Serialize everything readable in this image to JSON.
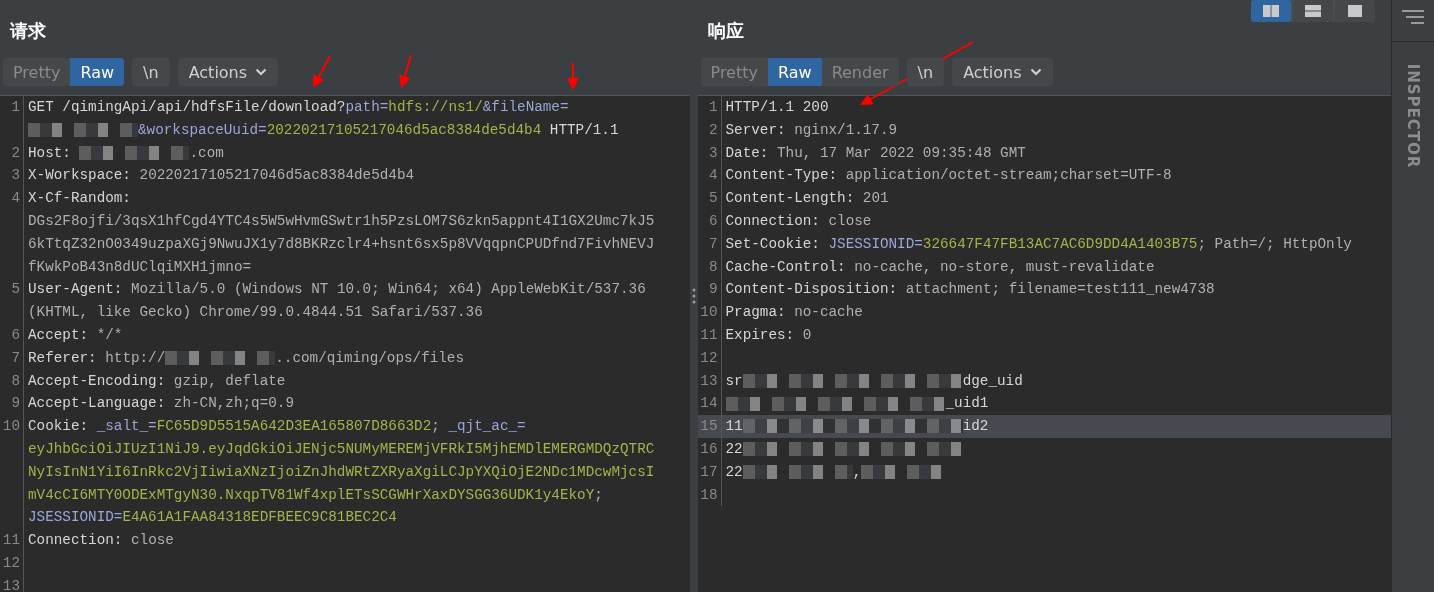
{
  "panes": [
    {
      "title": "请求",
      "view_tabs": [
        {
          "label": "Pretty",
          "selected": false
        },
        {
          "label": "Raw",
          "selected": true
        }
      ],
      "buttons": [
        {
          "label": "\\n",
          "kind": "plain"
        },
        {
          "label": "Actions",
          "kind": "menu"
        }
      ],
      "lines": [
        {
          "number": "1",
          "selected": false,
          "wraps": [
            {
              "segments": [
                {
                  "kind": "hname",
                  "text": "GET /qimingApi/api/hdfsFile/download?"
                },
                {
                  "kind": "pname",
                  "text": "path="
                },
                {
                  "kind": "pval",
                  "text": "hdfs://ns1/"
                },
                {
                  "kind": "pname",
                  "text": "&fileName="
                }
              ]
            },
            {
              "segments": [
                {
                  "kind": "redacted"
                },
                {
                  "kind": "pname",
                  "text": "&workspaceUuid="
                },
                {
                  "kind": "pval",
                  "text": "20220217105217046d5ac8384de5d4b4"
                },
                {
                  "kind": "hname",
                  "text": " HTTP/1.1"
                }
              ]
            }
          ]
        },
        {
          "number": "2",
          "selected": false,
          "wraps": [
            {
              "segments": [
                {
                  "kind": "hname",
                  "text": "Host: "
                },
                {
                  "kind": "redacted"
                },
                {
                  "kind": "hval",
                  "text": ".com"
                }
              ]
            }
          ]
        },
        {
          "number": "3",
          "selected": false,
          "wraps": [
            {
              "segments": [
                {
                  "kind": "hname",
                  "text": "X-Workspace: "
                },
                {
                  "kind": "hval",
                  "text": "20220217105217046d5ac8384de5d4b4"
                }
              ]
            }
          ]
        },
        {
          "number": "4",
          "selected": false,
          "wraps": [
            {
              "segments": [
                {
                  "kind": "hname",
                  "text": "X-Cf-Random:"
                }
              ]
            },
            {
              "segments": [
                {
                  "kind": "hval",
                  "text": "DGs2F8ojfi/3qsX1hfCgd4YTC4s5W5wHvmGSwtr1h5PzsLOM7S6zkn5appnt4I1GX2Umc7kJ5"
                }
              ]
            },
            {
              "segments": [
                {
                  "kind": "hval",
                  "text": "6kTtqZ32nO0349uzpaXGj9NwuJX1y7d8BKRzclr4+hsnt6sx5p8VVqqpnCPUDfnd7FivhNEVJ"
                }
              ]
            },
            {
              "segments": [
                {
                  "kind": "hval",
                  "text": "fKwkPoB43n8dUClqiMXH1jmno="
                }
              ]
            }
          ]
        },
        {
          "number": "5",
          "selected": false,
          "wraps": [
            {
              "segments": [
                {
                  "kind": "hname",
                  "text": "User-Agent: "
                },
                {
                  "kind": "hval",
                  "text": "Mozilla/5.0 (Windows NT 10.0; Win64; x64) AppleWebKit/537.36"
                }
              ]
            },
            {
              "segments": [
                {
                  "kind": "hval",
                  "text": "(KHTML, like Gecko) Chrome/99.0.4844.51 Safari/537.36"
                }
              ]
            }
          ]
        },
        {
          "number": "6",
          "selected": false,
          "wraps": [
            {
              "segments": [
                {
                  "kind": "hname",
                  "text": "Accept: "
                },
                {
                  "kind": "hval",
                  "text": "*/*"
                }
              ]
            }
          ]
        },
        {
          "number": "7",
          "selected": false,
          "wraps": [
            {
              "segments": [
                {
                  "kind": "hname",
                  "text": "Referer: "
                },
                {
                  "kind": "hval",
                  "text": "http://"
                },
                {
                  "kind": "redacted"
                },
                {
                  "kind": "hval",
                  "text": "..com/qiming/ops/files"
                }
              ]
            }
          ]
        },
        {
          "number": "8",
          "selected": false,
          "wraps": [
            {
              "segments": [
                {
                  "kind": "hname",
                  "text": "Accept-Encoding: "
                },
                {
                  "kind": "hval",
                  "text": "gzip, deflate"
                }
              ]
            }
          ]
        },
        {
          "number": "9",
          "selected": false,
          "wraps": [
            {
              "segments": [
                {
                  "kind": "hname",
                  "text": "Accept-Language: "
                },
                {
                  "kind": "hval",
                  "text": "zh-CN,zh;q=0.9"
                }
              ]
            }
          ]
        },
        {
          "number": "10",
          "selected": false,
          "wraps": [
            {
              "segments": [
                {
                  "kind": "hname",
                  "text": "Cookie: "
                },
                {
                  "kind": "pname",
                  "text": "_salt_="
                },
                {
                  "kind": "pval",
                  "text": "FC65D9D5515A642D3EA165807D8663D2"
                },
                {
                  "kind": "hval",
                  "text": "; "
                },
                {
                  "kind": "pname",
                  "text": "_qjt_ac_="
                }
              ]
            },
            {
              "segments": [
                {
                  "kind": "pval",
                  "text": "eyJhbGciOiJIUzI1NiJ9.eyJqdGkiOiJENjc5NUMyMEREMjVFRkI5MjhEMDlEMERGMDQzQTRC"
                }
              ]
            },
            {
              "segments": [
                {
                  "kind": "pval",
                  "text": "NyIsInN1YiI6InRkc2VjIiwiaXNzIjoiZnJhdWRtZXRyaXgiLCJpYXQiOjE2NDc1MDcwMjcsI"
                }
              ]
            },
            {
              "segments": [
                {
                  "kind": "pval",
                  "text": "mV4cCI6MTY0ODExMTgyN30.NxqpTV81Wf4xplETsSCGWHrXaxDYSGG36UDK1y4EkoY"
                },
                {
                  "kind": "hval",
                  "text": ";"
                }
              ]
            },
            {
              "segments": [
                {
                  "kind": "pname",
                  "text": "JSESSIONID="
                },
                {
                  "kind": "pval",
                  "text": "E4A61A1FAA84318EDFBEEC9C81BEC2C4"
                }
              ]
            }
          ]
        },
        {
          "number": "11",
          "selected": false,
          "wraps": [
            {
              "segments": [
                {
                  "kind": "hname",
                  "text": "Connection: "
                },
                {
                  "kind": "hval",
                  "text": "close"
                }
              ]
            }
          ]
        },
        {
          "number": "12",
          "selected": false
        },
        {
          "number": "13",
          "selected": false
        }
      ]
    },
    {
      "title": "响应",
      "view_tabs": [
        {
          "label": "Pretty",
          "selected": false
        },
        {
          "label": "Raw",
          "selected": true
        },
        {
          "label": "Render",
          "selected": false
        }
      ],
      "buttons": [
        {
          "label": "\\n",
          "kind": "plain"
        },
        {
          "label": "Actions",
          "kind": "menu"
        }
      ],
      "lines": [
        {
          "number": "1",
          "selected": false,
          "wraps": [
            {
              "segments": [
                {
                  "kind": "hname",
                  "text": "HTTP/1.1 200"
                }
              ]
            }
          ]
        },
        {
          "number": "2",
          "selected": false,
          "wraps": [
            {
              "segments": [
                {
                  "kind": "hname",
                  "text": "Server: "
                },
                {
                  "kind": "hval",
                  "text": "nginx/1.17.9"
                }
              ]
            }
          ]
        },
        {
          "number": "3",
          "selected": false,
          "wraps": [
            {
              "segments": [
                {
                  "kind": "hname",
                  "text": "Date: "
                },
                {
                  "kind": "hval",
                  "text": "Thu, 17 Mar 2022 09:35:48 GMT"
                }
              ]
            }
          ]
        },
        {
          "number": "4",
          "selected": false,
          "wraps": [
            {
              "segments": [
                {
                  "kind": "hname",
                  "text": "Content-Type: "
                },
                {
                  "kind": "hval",
                  "text": "application/octet-stream;charset=UTF-8"
                }
              ]
            }
          ]
        },
        {
          "number": "5",
          "selected": false,
          "wraps": [
            {
              "segments": [
                {
                  "kind": "hname",
                  "text": "Content-Length: "
                },
                {
                  "kind": "hval",
                  "text": "201"
                }
              ]
            }
          ]
        },
        {
          "number": "6",
          "selected": false,
          "wraps": [
            {
              "segments": [
                {
                  "kind": "hname",
                  "text": "Connection: "
                },
                {
                  "kind": "hval",
                  "text": "close"
                }
              ]
            }
          ]
        },
        {
          "number": "7",
          "selected": false,
          "wraps": [
            {
              "segments": [
                {
                  "kind": "hname",
                  "text": "Set-Cookie: "
                },
                {
                  "kind": "pname",
                  "text": "JSESSIONID="
                },
                {
                  "kind": "pval",
                  "text": "326647F47FB13AC7AC6D9DD4A1403B75"
                },
                {
                  "kind": "hval",
                  "text": "; Path=/; HttpOnly"
                }
              ]
            }
          ]
        },
        {
          "number": "8",
          "selected": false,
          "wraps": [
            {
              "segments": [
                {
                  "kind": "hname",
                  "text": "Cache-Control: "
                },
                {
                  "kind": "hval",
                  "text": "no-cache, no-store, must-revalidate"
                }
              ]
            }
          ]
        },
        {
          "number": "9",
          "selected": false,
          "wraps": [
            {
              "segments": [
                {
                  "kind": "hname",
                  "text": "Content-Disposition: "
                },
                {
                  "kind": "hval",
                  "text": "attachment; filename=test111_new4738"
                }
              ]
            }
          ]
        },
        {
          "number": "10",
          "selected": false,
          "wraps": [
            {
              "segments": [
                {
                  "kind": "hname",
                  "text": "Pragma: "
                },
                {
                  "kind": "hval",
                  "text": "no-cache"
                }
              ]
            }
          ]
        },
        {
          "number": "11",
          "selected": false,
          "wraps": [
            {
              "segments": [
                {
                  "kind": "hname",
                  "text": "Expires: "
                },
                {
                  "kind": "hval",
                  "text": "0"
                }
              ]
            }
          ]
        },
        {
          "number": "12",
          "selected": false
        },
        {
          "number": "13",
          "selected": false,
          "wraps": [
            {
              "segments": [
                {
                  "kind": "hname",
                  "text": "sr"
                },
                {
                  "kind": "redacted_long"
                },
                {
                  "kind": "hname",
                  "text": "dge_uid"
                }
              ]
            }
          ]
        },
        {
          "number": "14",
          "selected": false,
          "wraps": [
            {
              "segments": [
                {
                  "kind": "redacted_long"
                },
                {
                  "kind": "hname",
                  "text": "_uid1"
                }
              ]
            }
          ]
        },
        {
          "number": "15",
          "selected": true,
          "wraps": [
            {
              "segments": [
                {
                  "kind": "hname",
                  "text": "11"
                },
                {
                  "kind": "redacted_long"
                },
                {
                  "kind": "hname",
                  "text": "id2"
                }
              ]
            }
          ]
        },
        {
          "number": "16",
          "selected": false,
          "wraps": [
            {
              "segments": [
                {
                  "kind": "hname",
                  "text": "22"
                },
                {
                  "kind": "redacted_long"
                }
              ]
            }
          ]
        },
        {
          "number": "17",
          "selected": false,
          "wraps": [
            {
              "segments": [
                {
                  "kind": "hname",
                  "text": "22"
                },
                {
                  "kind": "redacted"
                },
                {
                  "kind": "hname",
                  "text": ","
                },
                {
                  "kind": "redacted_short"
                }
              ]
            }
          ]
        },
        {
          "number": "18",
          "selected": false
        }
      ]
    }
  ],
  "layout_buttons": [
    {
      "kind": "columns",
      "selected": true
    },
    {
      "kind": "rows",
      "selected": false
    },
    {
      "kind": "single",
      "selected": false
    }
  ],
  "inspector": {
    "label": "INSPECTOR"
  }
}
